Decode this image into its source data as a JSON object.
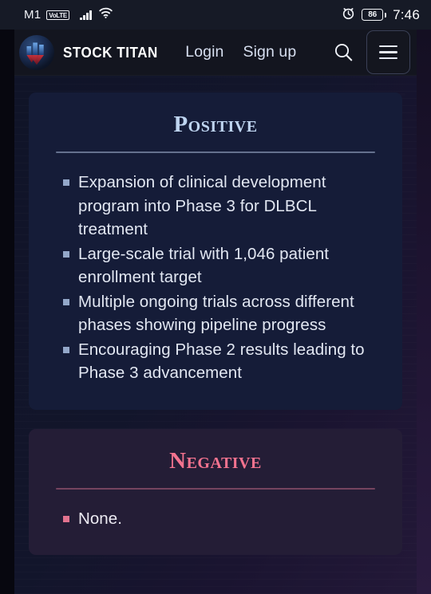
{
  "status_bar": {
    "carrier": "M1",
    "network_badge": "VoLTE",
    "signal_icon": "signal-bars-icon",
    "wifi_icon": "wifi-icon",
    "alarm_icon": "alarm-clock-icon",
    "battery_level": "86",
    "time": "7:46"
  },
  "header": {
    "logo_icon": "stock-titan-logo-icon",
    "brand_name": "STOCK TITAN",
    "nav": [
      {
        "label": "Login",
        "name": "login-link"
      },
      {
        "label": "Sign up",
        "name": "signup-link"
      }
    ],
    "search_icon": "search-icon",
    "menu_icon": "hamburger-menu-icon"
  },
  "main": {
    "cards": [
      {
        "title": "Positive",
        "accent": "#bed4f0",
        "bullets": [
          "Expansion of clinical development program into Phase 3 for DLBCL treatment",
          "Large-scale trial with 1,046 patient enrollment target",
          "Multiple ongoing trials across different phases showing pipeline progress",
          "Encouraging Phase 2 results leading to Phase 3 advancement"
        ]
      },
      {
        "title": "Negative",
        "accent": "#f4738f",
        "bullets": [
          "None."
        ]
      }
    ]
  },
  "colors": {
    "page_bg": "#101428",
    "positive_card_bg": "#151c38",
    "negative_card_bg": "#241d36",
    "header_bg": "#13151f",
    "status_bar_bg": "#161a26",
    "positive_accent": "#bed4f0",
    "negative_accent": "#f4738f",
    "body_text": "#e2e7f2"
  }
}
